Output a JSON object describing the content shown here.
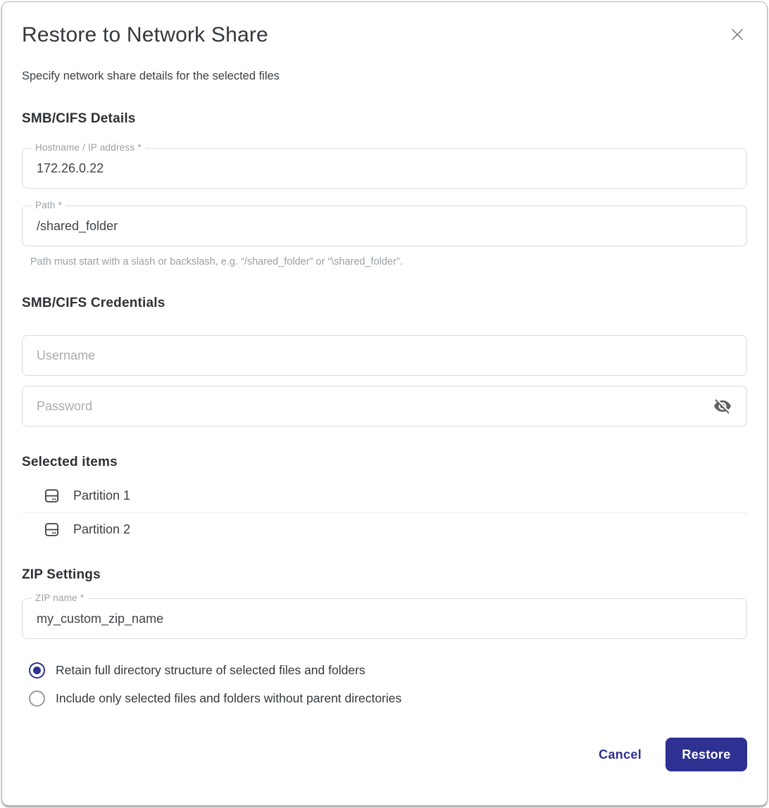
{
  "colors": {
    "accent": "#2e3192",
    "border": "#d8dadc",
    "label_gray": "#9aa0a6"
  },
  "dialog": {
    "title": "Restore to Network Share",
    "subtitle": "Specify network share details for the selected files"
  },
  "smb_details": {
    "heading": "SMB/CIFS Details",
    "hostname_label": "Hostname / IP address *",
    "hostname_value": "172.26.0.22",
    "path_label": "Path *",
    "path_value": "/shared_folder",
    "path_helper": "Path must start with a slash or backslash, e.g. “/shared_folder” or “\\shared_folder”."
  },
  "credentials": {
    "heading": "SMB/CIFS Credentials",
    "username_placeholder": "Username",
    "password_placeholder": "Password",
    "password_visibility": "hidden"
  },
  "selected_items": {
    "heading": "Selected items",
    "items": [
      {
        "label": "Partition 1",
        "icon": "partition-icon"
      },
      {
        "label": "Partition 2",
        "icon": "partition-icon"
      }
    ]
  },
  "zip_settings": {
    "heading": "ZIP Settings",
    "zip_name_label": "ZIP name *",
    "zip_name_value": "my_custom_zip_name",
    "options": [
      {
        "label": "Retain full directory structure of selected files and folders",
        "selected": true
      },
      {
        "label": "Include only selected files and folders without parent directories",
        "selected": false
      }
    ]
  },
  "actions": {
    "cancel_label": "Cancel",
    "restore_label": "Restore"
  }
}
